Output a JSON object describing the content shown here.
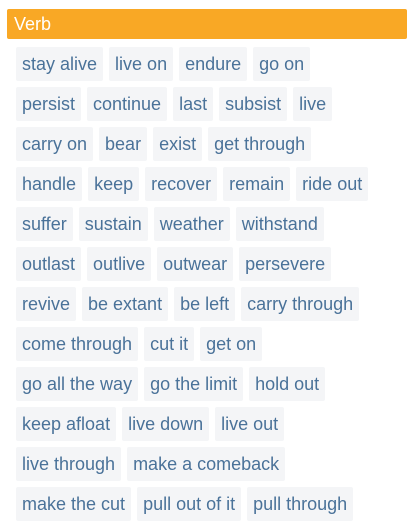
{
  "header": {
    "title": "Verb"
  },
  "rows": [
    [
      "stay alive",
      "live on",
      "endure",
      "go on"
    ],
    [
      "persist",
      "continue",
      "last",
      "subsist",
      "live"
    ],
    [
      "carry on",
      "bear",
      "exist",
      "get through"
    ],
    [
      "handle",
      "keep",
      "recover",
      "remain",
      "ride out"
    ],
    [
      "suffer",
      "sustain",
      "weather",
      "withstand"
    ],
    [
      "outlast",
      "outlive",
      "outwear",
      "persevere"
    ],
    [
      "revive",
      "be extant",
      "be left",
      "carry through"
    ],
    [
      "come through",
      "cut it",
      "get on"
    ],
    [
      "go all the way",
      "go the limit",
      "hold out"
    ],
    [
      "keep afloat",
      "live down",
      "live out"
    ],
    [
      "live through",
      "make a comeback"
    ],
    [
      "make the cut",
      "pull out of it",
      "pull through"
    ]
  ],
  "colors": {
    "header_bg": "#f9a825",
    "header_text": "#ffffff",
    "chip_bg": "#f4f5f7",
    "chip_text": "#4a7299"
  }
}
